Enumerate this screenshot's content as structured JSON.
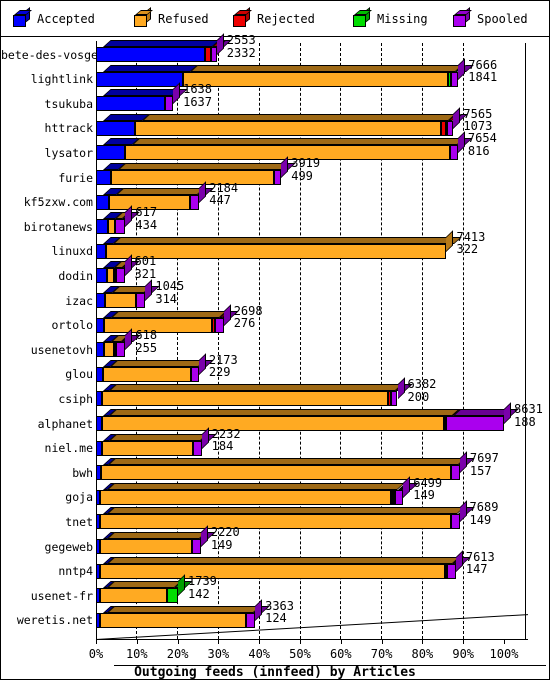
{
  "legend": {
    "items": [
      {
        "label": "Accepted",
        "color": "#0000ff",
        "icon": "cube-icon"
      },
      {
        "label": "Refused",
        "color": "#ffaa22",
        "icon": "cube-icon"
      },
      {
        "label": "Rejected",
        "color": "#ee0000",
        "icon": "cube-icon"
      },
      {
        "label": "Missing",
        "color": "#00dd00",
        "icon": "cube-icon"
      },
      {
        "label": "Spooled",
        "color": "#aa00ee",
        "icon": "cube-icon"
      }
    ]
  },
  "chart_data": {
    "type": "bar",
    "orientation": "horizontal",
    "stacked": true,
    "title": "Outgoing feeds (innfeed) by Articles",
    "xlabel": "Outgoing feeds (innfeed) by Articles",
    "ylabel": "",
    "xlim": [
      0,
      100
    ],
    "xunit": "%",
    "grid": true,
    "legend_position": "top",
    "xticks": [
      "0%",
      "10%",
      "20%",
      "30%",
      "40%",
      "50%",
      "60%",
      "70%",
      "80%",
      "90%",
      "100%"
    ],
    "xtick_values": [
      0,
      10,
      20,
      30,
      40,
      50,
      60,
      70,
      80,
      90,
      100
    ],
    "series": [
      {
        "name": "Accepted",
        "color": "#0000ff"
      },
      {
        "name": "Refused",
        "color": "#ffaa22"
      },
      {
        "name": "Rejected",
        "color": "#ee0000"
      },
      {
        "name": "Missing",
        "color": "#00dd00"
      },
      {
        "name": "Spooled",
        "color": "#aa00ee"
      }
    ],
    "categories": [
      "bete-des-vosges",
      "lightlink",
      "tsukuba",
      "httrack",
      "lysator",
      "furie",
      "kf5zxw.com",
      "birotanews",
      "linuxd",
      "dodin",
      "izac",
      "ortolo",
      "usenetovh",
      "glou",
      "csiph",
      "alphanet",
      "niel.me",
      "bwh",
      "goja",
      "tnet",
      "gegeweb",
      "nntp4",
      "usenet-fr",
      "weretis.net"
    ],
    "rows": [
      {
        "category": "bete-des-vosges",
        "total": 2553,
        "value2": 2332,
        "percent": 29.6,
        "segments": [
          {
            "name": "Accepted",
            "pct": 26.6
          },
          {
            "name": "Refused",
            "pct": 0.0
          },
          {
            "name": "Rejected",
            "pct": 1.5
          },
          {
            "name": "Missing",
            "pct": 0.0
          },
          {
            "name": "Spooled",
            "pct": 1.5
          }
        ]
      },
      {
        "category": "lightlink",
        "total": 7666,
        "value2": 1841,
        "percent": 88.8,
        "segments": [
          {
            "name": "Accepted",
            "pct": 21.3
          },
          {
            "name": "Refused",
            "pct": 65.0
          },
          {
            "name": "Rejected",
            "pct": 0.0
          },
          {
            "name": "Missing",
            "pct": 0.6
          },
          {
            "name": "Spooled",
            "pct": 1.9
          }
        ]
      },
      {
        "category": "tsukuba",
        "total": 1638,
        "value2": 1637,
        "percent": 18.9,
        "segments": [
          {
            "name": "Accepted",
            "pct": 17.0
          },
          {
            "name": "Refused",
            "pct": 0.0
          },
          {
            "name": "Rejected",
            "pct": 0.0
          },
          {
            "name": "Missing",
            "pct": 0.0
          },
          {
            "name": "Spooled",
            "pct": 1.9
          }
        ]
      },
      {
        "category": "httrack",
        "total": 7565,
        "value2": 1073,
        "percent": 87.6,
        "segments": [
          {
            "name": "Accepted",
            "pct": 9.6
          },
          {
            "name": "Refused",
            "pct": 75.0
          },
          {
            "name": "Rejected",
            "pct": 1.1
          },
          {
            "name": "Missing",
            "pct": 0.4
          },
          {
            "name": "Spooled",
            "pct": 1.5
          }
        ]
      },
      {
        "category": "lysator",
        "total": 7654,
        "value2": 816,
        "percent": 88.7,
        "segments": [
          {
            "name": "Accepted",
            "pct": 7.2
          },
          {
            "name": "Refused",
            "pct": 79.6
          },
          {
            "name": "Rejected",
            "pct": 0.0
          },
          {
            "name": "Missing",
            "pct": 0.0
          },
          {
            "name": "Spooled",
            "pct": 1.9
          }
        ]
      },
      {
        "category": "furie",
        "total": 3919,
        "value2": 499,
        "percent": 45.4,
        "segments": [
          {
            "name": "Accepted",
            "pct": 3.7
          },
          {
            "name": "Refused",
            "pct": 39.9
          },
          {
            "name": "Rejected",
            "pct": 0.0
          },
          {
            "name": "Missing",
            "pct": 0.0
          },
          {
            "name": "Spooled",
            "pct": 1.8
          }
        ]
      },
      {
        "category": "kf5zxw.com",
        "total": 2184,
        "value2": 447,
        "percent": 25.3,
        "segments": [
          {
            "name": "Accepted",
            "pct": 3.2
          },
          {
            "name": "Refused",
            "pct": 19.9
          },
          {
            "name": "Rejected",
            "pct": 0.0
          },
          {
            "name": "Missing",
            "pct": 0.0
          },
          {
            "name": "Spooled",
            "pct": 2.2
          }
        ]
      },
      {
        "category": "birotanews",
        "total": 617,
        "value2": 434,
        "percent": 7.2,
        "segments": [
          {
            "name": "Accepted",
            "pct": 2.9
          },
          {
            "name": "Refused",
            "pct": 1.8
          },
          {
            "name": "Rejected",
            "pct": 0.0
          },
          {
            "name": "Missing",
            "pct": 0.0
          },
          {
            "name": "Spooled",
            "pct": 2.5
          }
        ]
      },
      {
        "category": "linuxd",
        "total": 7413,
        "value2": 322,
        "percent": 85.9,
        "segments": [
          {
            "name": "Accepted",
            "pct": 2.4
          },
          {
            "name": "Refused",
            "pct": 83.5
          },
          {
            "name": "Rejected",
            "pct": 0.0
          },
          {
            "name": "Missing",
            "pct": 0.0
          },
          {
            "name": "Spooled",
            "pct": 0.0
          }
        ]
      },
      {
        "category": "dodin",
        "total": 601,
        "value2": 321,
        "percent": 7.0,
        "segments": [
          {
            "name": "Accepted",
            "pct": 2.6
          },
          {
            "name": "Refused",
            "pct": 1.9
          },
          {
            "name": "Rejected",
            "pct": 0.4
          },
          {
            "name": "Missing",
            "pct": 0.0
          },
          {
            "name": "Spooled",
            "pct": 2.1
          }
        ]
      },
      {
        "category": "izac",
        "total": 1045,
        "value2": 314,
        "percent": 12.1,
        "segments": [
          {
            "name": "Accepted",
            "pct": 2.1
          },
          {
            "name": "Refused",
            "pct": 7.8
          },
          {
            "name": "Rejected",
            "pct": 0.0
          },
          {
            "name": "Missing",
            "pct": 0.0
          },
          {
            "name": "Spooled",
            "pct": 2.2
          }
        ]
      },
      {
        "category": "ortolo",
        "total": 2698,
        "value2": 276,
        "percent": 31.3,
        "segments": [
          {
            "name": "Accepted",
            "pct": 2.0
          },
          {
            "name": "Refused",
            "pct": 26.4
          },
          {
            "name": "Rejected",
            "pct": 0.7
          },
          {
            "name": "Missing",
            "pct": 0.0
          },
          {
            "name": "Spooled",
            "pct": 2.2
          }
        ]
      },
      {
        "category": "usenetovh",
        "total": 618,
        "value2": 255,
        "percent": 7.2,
        "segments": [
          {
            "name": "Accepted",
            "pct": 1.9
          },
          {
            "name": "Refused",
            "pct": 2.4
          },
          {
            "name": "Rejected",
            "pct": 0.5
          },
          {
            "name": "Missing",
            "pct": 0.0
          },
          {
            "name": "Spooled",
            "pct": 2.4
          }
        ]
      },
      {
        "category": "glou",
        "total": 2173,
        "value2": 229,
        "percent": 25.2,
        "segments": [
          {
            "name": "Accepted",
            "pct": 1.7
          },
          {
            "name": "Refused",
            "pct": 21.5
          },
          {
            "name": "Rejected",
            "pct": 0.0
          },
          {
            "name": "Missing",
            "pct": 0.0
          },
          {
            "name": "Spooled",
            "pct": 2.0
          }
        ]
      },
      {
        "category": "csiph",
        "total": 6382,
        "value2": 200,
        "percent": 73.9,
        "segments": [
          {
            "name": "Accepted",
            "pct": 1.5
          },
          {
            "name": "Refused",
            "pct": 70.0
          },
          {
            "name": "Rejected",
            "pct": 0.7
          },
          {
            "name": "Missing",
            "pct": 0.0
          },
          {
            "name": "Spooled",
            "pct": 1.7
          }
        ]
      },
      {
        "category": "alphanet",
        "total": 8631,
        "value2": 188,
        "percent": 100.0,
        "segments": [
          {
            "name": "Accepted",
            "pct": 1.4
          },
          {
            "name": "Refused",
            "pct": 84.0
          },
          {
            "name": "Rejected",
            "pct": 0.3
          },
          {
            "name": "Missing",
            "pct": 0.0
          },
          {
            "name": "Spooled",
            "pct": 14.3
          }
        ]
      },
      {
        "category": "niel.me",
        "total": 2232,
        "value2": 184,
        "percent": 25.9,
        "segments": [
          {
            "name": "Accepted",
            "pct": 1.4
          },
          {
            "name": "Refused",
            "pct": 22.4
          },
          {
            "name": "Rejected",
            "pct": 0.0
          },
          {
            "name": "Missing",
            "pct": 0.0
          },
          {
            "name": "Spooled",
            "pct": 2.1
          }
        ]
      },
      {
        "category": "bwh",
        "total": 7697,
        "value2": 157,
        "percent": 89.2,
        "segments": [
          {
            "name": "Accepted",
            "pct": 1.2
          },
          {
            "name": "Refused",
            "pct": 85.8
          },
          {
            "name": "Rejected",
            "pct": 0.0
          },
          {
            "name": "Missing",
            "pct": 0.0
          },
          {
            "name": "Spooled",
            "pct": 2.2
          }
        ]
      },
      {
        "category": "goja",
        "total": 6499,
        "value2": 149,
        "percent": 75.3,
        "segments": [
          {
            "name": "Accepted",
            "pct": 1.1
          },
          {
            "name": "Refused",
            "pct": 71.2
          },
          {
            "name": "Rejected",
            "pct": 0.6
          },
          {
            "name": "Missing",
            "pct": 0.3
          },
          {
            "name": "Spooled",
            "pct": 2.1
          }
        ]
      },
      {
        "category": "tnet",
        "total": 7689,
        "value2": 149,
        "percent": 89.1,
        "segments": [
          {
            "name": "Accepted",
            "pct": 1.1
          },
          {
            "name": "Refused",
            "pct": 85.9
          },
          {
            "name": "Rejected",
            "pct": 0.0
          },
          {
            "name": "Missing",
            "pct": 0.0
          },
          {
            "name": "Spooled",
            "pct": 2.1
          }
        ]
      },
      {
        "category": "gegeweb",
        "total": 2220,
        "value2": 149,
        "percent": 25.7,
        "segments": [
          {
            "name": "Accepted",
            "pct": 1.1
          },
          {
            "name": "Refused",
            "pct": 22.5
          },
          {
            "name": "Rejected",
            "pct": 0.0
          },
          {
            "name": "Missing",
            "pct": 0.0
          },
          {
            "name": "Spooled",
            "pct": 2.1
          }
        ]
      },
      {
        "category": "nntp4",
        "total": 7613,
        "value2": 147,
        "percent": 88.2,
        "segments": [
          {
            "name": "Accepted",
            "pct": 1.1
          },
          {
            "name": "Refused",
            "pct": 84.5
          },
          {
            "name": "Rejected",
            "pct": 0.5
          },
          {
            "name": "Missing",
            "pct": 0.0
          },
          {
            "name": "Spooled",
            "pct": 2.1
          }
        ]
      },
      {
        "category": "usenet-fr",
        "total": 1739,
        "value2": 142,
        "percent": 20.1,
        "segments": [
          {
            "name": "Accepted",
            "pct": 1.1
          },
          {
            "name": "Refused",
            "pct": 16.3
          },
          {
            "name": "Rejected",
            "pct": 0.0
          },
          {
            "name": "Missing",
            "pct": 2.7
          },
          {
            "name": "Spooled",
            "pct": 0.0
          }
        ]
      },
      {
        "category": "weretis.net",
        "total": 3363,
        "value2": 124,
        "percent": 39.0,
        "segments": [
          {
            "name": "Accepted",
            "pct": 1.0
          },
          {
            "name": "Refused",
            "pct": 35.7
          },
          {
            "name": "Rejected",
            "pct": 0.0
          },
          {
            "name": "Missing",
            "pct": 0.0
          },
          {
            "name": "Spooled",
            "pct": 2.3
          }
        ]
      }
    ]
  }
}
